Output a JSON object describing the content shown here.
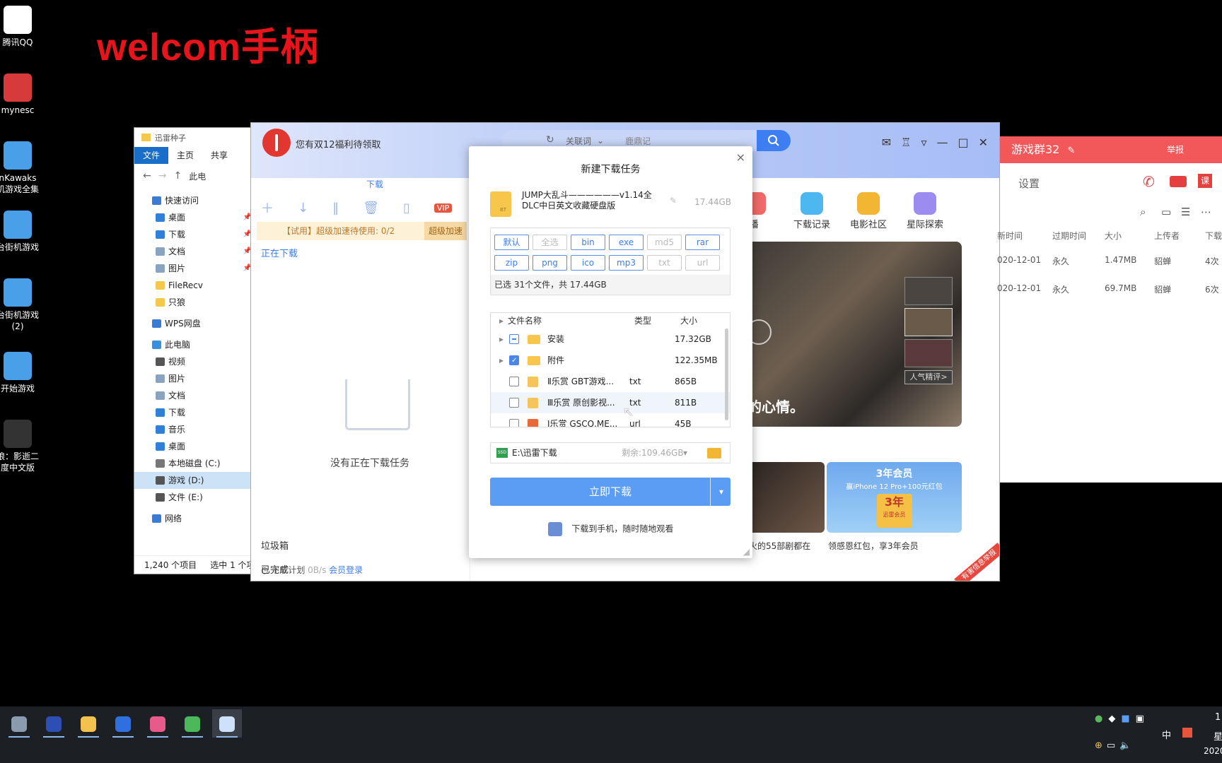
{
  "overlay_title": "welcom手柄",
  "desktop_icons": [
    {
      "label": "腾讯QQ",
      "color": "#ffffff"
    },
    {
      "label": "mynesc",
      "color": "#d63a3a"
    },
    {
      "label": "nKawaks\n机游戏全集",
      "color": "#4aa0e8"
    },
    {
      "label": "台街机游戏",
      "color": "#4aa0e8"
    },
    {
      "label": "台街机游戏\n(2)",
      "color": "#4aa0e8"
    },
    {
      "label": "开始游戏",
      "color": "#4aa0e8"
    },
    {
      "label": "狼：影逝二\n度中文版",
      "color": "#333333"
    }
  ],
  "explorer": {
    "title": "迅雷种子",
    "tabs": [
      "文件",
      "主页",
      "共享"
    ],
    "addr": "此电",
    "nav": [
      {
        "label": "快速访问",
        "color": "#3a7bd5",
        "pin": false
      },
      {
        "label": "桌面",
        "color": "#2f80d9",
        "pin": true
      },
      {
        "label": "下载",
        "color": "#2f80d9",
        "pin": true
      },
      {
        "label": "文档",
        "color": "#8aa4c0",
        "pin": true
      },
      {
        "label": "图片",
        "color": "#8aa4c0",
        "pin": true
      },
      {
        "label": "FileRecv",
        "color": "#f5c84c",
        "pin": false
      },
      {
        "label": "只狼",
        "color": "#f5c84c",
        "pin": false
      },
      {
        "label": "WPS网盘",
        "color": "#3a7bd5",
        "pin": false
      },
      {
        "label": "此电脑",
        "color": "#3a8ee0",
        "pin": false
      },
      {
        "label": "视频",
        "color": "#555555",
        "pin": false
      },
      {
        "label": "图片",
        "color": "#8aa4c0",
        "pin": false
      },
      {
        "label": "文档",
        "color": "#8aa4c0",
        "pin": false
      },
      {
        "label": "下载",
        "color": "#2f80d9",
        "pin": false
      },
      {
        "label": "音乐",
        "color": "#2f80d9",
        "pin": false
      },
      {
        "label": "桌面",
        "color": "#2f80d9",
        "pin": false
      },
      {
        "label": "本地磁盘 (C:)",
        "color": "#777777",
        "pin": false
      },
      {
        "label": "游戏 (D:)",
        "color": "#555555",
        "pin": false
      },
      {
        "label": "文件 (E:)",
        "color": "#555555",
        "pin": false
      },
      {
        "label": "网络",
        "color": "#3a7bd5",
        "pin": false
      }
    ],
    "status_count": "1,240 个项目",
    "status_selected": "选中 1 个项"
  },
  "xunlei": {
    "notice": "您有双12福利待领取",
    "search_keyword": "关联词",
    "search_placeholder": "鹿鼎记",
    "tab_download": "下载",
    "promo": "【试用】超级加速待使用: 0/2",
    "promo_badge": "超级加速",
    "downloading": "正在下载",
    "empty": "没有正在下载任务",
    "completed": "已完成",
    "trash": "垃圾箱",
    "plan": "下载计划",
    "speed": "0B/s",
    "login": "会员登录",
    "features": [
      {
        "label": "播",
        "color": "#f06a6a"
      },
      {
        "label": "下载记录",
        "color": "#4db8f0"
      },
      {
        "label": "电影社区",
        "color": "#f2b632"
      },
      {
        "label": "星际探索",
        "color": "#9d8cf0"
      }
    ],
    "banner_text": "的心情。",
    "hot_pick": "人气精评>",
    "cards": [
      {
        "caption": "火的55部剧都在",
        "color": "#4a3c32"
      },
      {
        "caption": "领感恩红包，享3年会员",
        "color": "#7ab8f2"
      }
    ],
    "card_promo_title": "3年会员",
    "card_promo_sub": "赢iPhone 12 Pro+100元红包",
    "card_promo_big": "3年",
    "card_promo_vip": "迅雷会员",
    "card_stamp": "有害信息举报"
  },
  "dialog": {
    "title": "新建下载任务",
    "torrent_name": "JUMP大乱斗——————v1.14全DLC中日英文收藏硬盘版",
    "torrent_size": "17.44GB",
    "chips": [
      {
        "label": "默认",
        "enabled": true
      },
      {
        "label": "全选",
        "enabled": false
      },
      {
        "label": "bin",
        "enabled": true
      },
      {
        "label": "exe",
        "enabled": true
      },
      {
        "label": "md5",
        "enabled": false
      },
      {
        "label": "rar",
        "enabled": true
      },
      {
        "label": "zip",
        "enabled": true
      },
      {
        "label": "png",
        "enabled": true
      },
      {
        "label": "ico",
        "enabled": true
      },
      {
        "label": "mp3",
        "enabled": true
      },
      {
        "label": "txt",
        "enabled": false
      },
      {
        "label": "url",
        "enabled": false
      }
    ],
    "selected_info": "已选 31个文件，共 17.44GB",
    "columns": {
      "name": "文件名称",
      "type": "类型",
      "size": "大小"
    },
    "files": [
      {
        "name": "安装",
        "type": "",
        "size": "17.32GB",
        "kind": "folder",
        "check": "part"
      },
      {
        "name": "附件",
        "type": "",
        "size": "122.35MB",
        "kind": "folder",
        "check": "on"
      },
      {
        "name": "Ⅱ乐赏 GBT游戏...",
        "type": "txt",
        "size": "865B",
        "kind": "doc",
        "check": "off"
      },
      {
        "name": "Ⅲ乐赏 原创影视...",
        "type": "txt",
        "size": "811B",
        "kind": "doc",
        "check": "off"
      },
      {
        "name": "Ⅰ乐赏 GSCQ.ME...",
        "type": "url",
        "size": "45B",
        "kind": "url",
        "check": "off"
      }
    ],
    "save_path": "E:\\迅雷下载",
    "free_space": "剩余:109.46GB",
    "download_now": "立即下载",
    "to_phone": "下载到手机，随时随地观看"
  },
  "group": {
    "title": "游戏群32",
    "report": "举报",
    "settings": "设置",
    "headers": [
      "新时间",
      "过期时间",
      "大小",
      "上传者",
      "下载"
    ],
    "rows": [
      [
        "020-12-01",
        "永久",
        "1.47MB",
        "貂蝉",
        "4次"
      ],
      [
        "020-12-01",
        "永久",
        "69.7MB",
        "貂蝉",
        "6次"
      ]
    ]
  },
  "taskbar": {
    "apps": [
      {
        "name": "system-app",
        "color": "#8a9bb0",
        "active": true
      },
      {
        "name": "wewin-app",
        "color": "#2d4fb5",
        "active": true
      },
      {
        "name": "explorer-app",
        "color": "#f2c14e",
        "active": true
      },
      {
        "name": "wps-app",
        "color": "#2f6fe0",
        "active": true
      },
      {
        "name": "photos-app",
        "color": "#e85a8a",
        "active": true
      },
      {
        "name": "browser-app",
        "color": "#4cb85c",
        "active": true
      },
      {
        "name": "xunlei-app",
        "color": "#cfe0fb",
        "active": true
      }
    ],
    "ime": "中",
    "time": "1",
    "weekday": "星",
    "year": "2020"
  }
}
